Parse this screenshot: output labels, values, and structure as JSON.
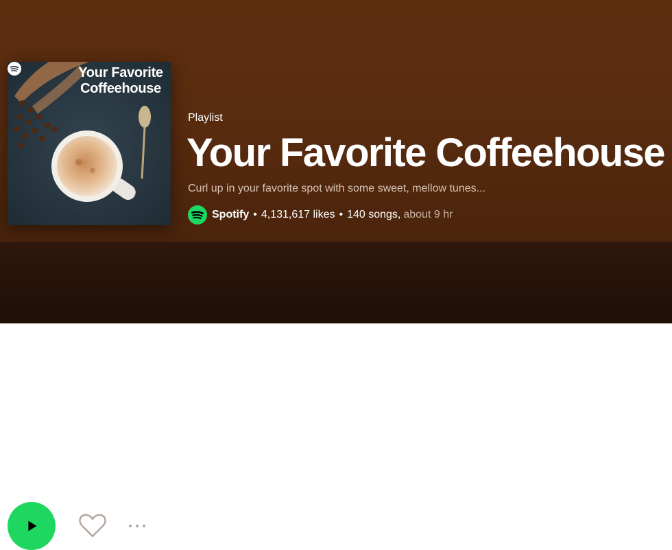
{
  "cover": {
    "title_line1": "Your Favorite",
    "title_line2": "Coffeehouse"
  },
  "playlist": {
    "type_label": "Playlist",
    "title": "Your Favorite Coffeehouse",
    "description": "Curl up in your favorite spot with some sweet, mellow tunes...",
    "owner": "Spotify",
    "likes": "4,131,617 likes",
    "songs": "140 songs,",
    "duration": "about 9 hr",
    "separator": "•"
  },
  "actions": {
    "play_icon": "play-icon",
    "like_icon": "heart-icon",
    "more_icon": "more-options-icon"
  },
  "colors": {
    "hero_bg": "#5e2e0f",
    "action_bg": "#1e0f07",
    "spotify_green": "#1ed760"
  }
}
